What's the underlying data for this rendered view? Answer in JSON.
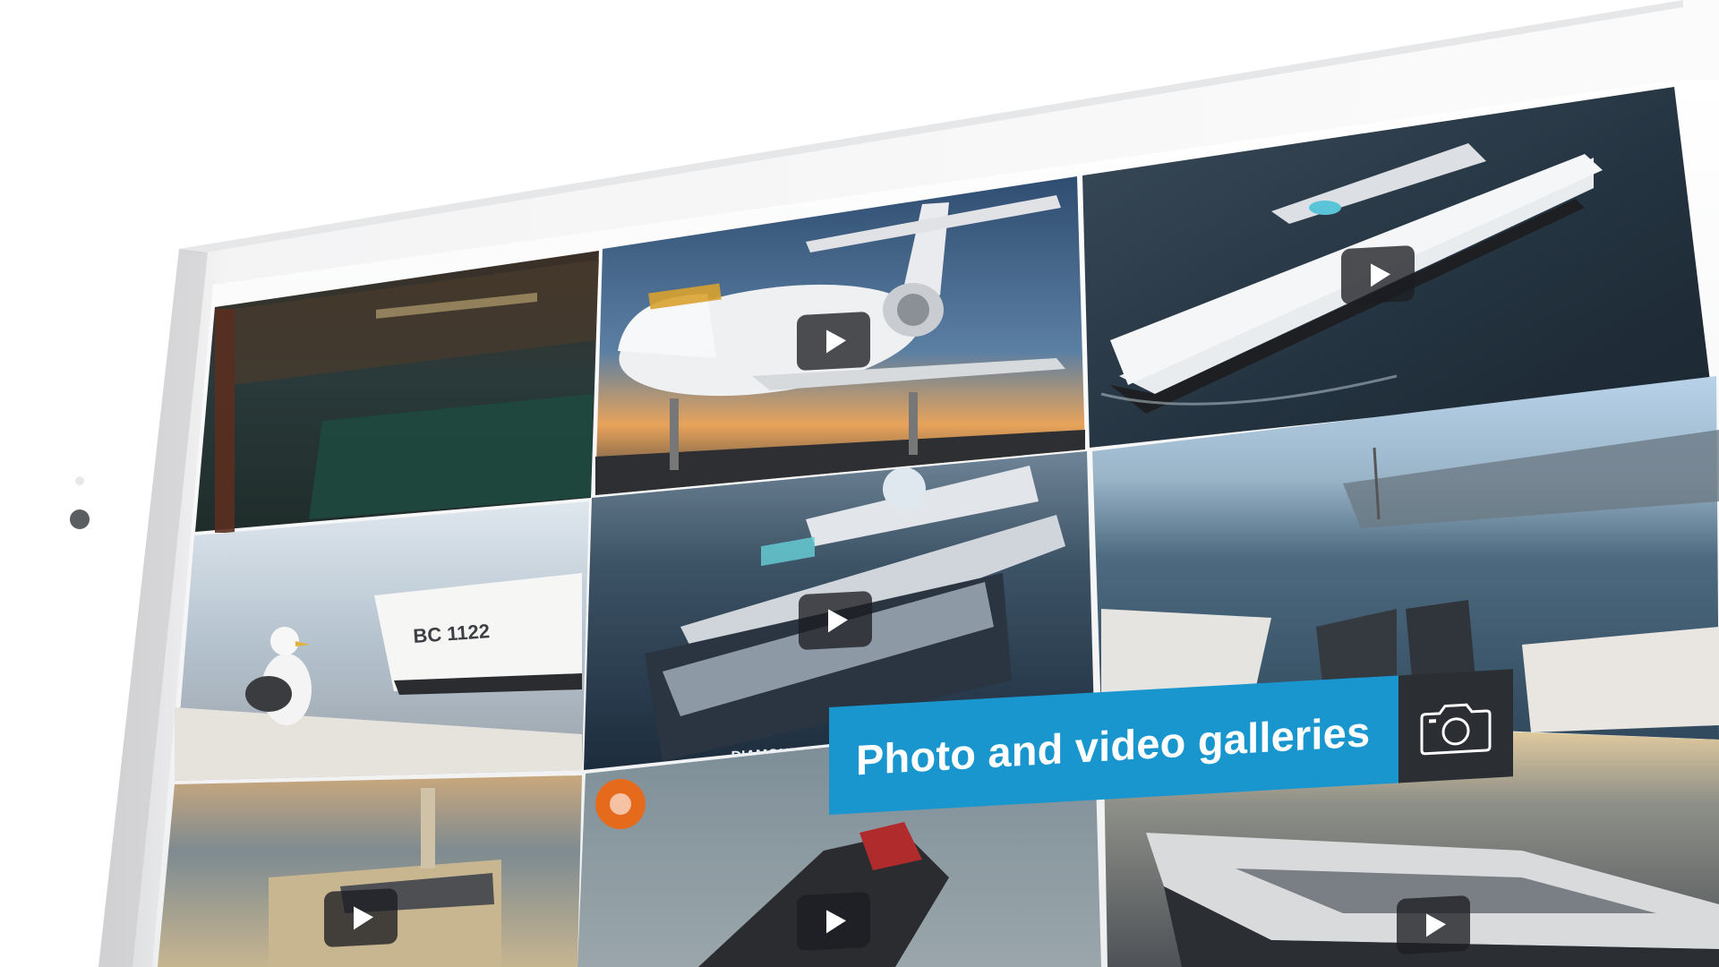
{
  "caption": {
    "label": "Photo and video galleries",
    "icon": "camera-icon",
    "accent_color": "#1a96cf",
    "icon_box_color": "#2b2e33"
  },
  "gallery": {
    "tiles": [
      {
        "name": "restaurant-bar",
        "has_play": false
      },
      {
        "name": "private-jet",
        "has_play": true
      },
      {
        "name": "superyacht-aerial",
        "has_play": true
      },
      {
        "name": "seagull-harbor",
        "has_play": false
      },
      {
        "name": "diamond-superyacht",
        "has_play": true,
        "overlay_text": "DIAMOND SU"
      },
      {
        "name": "fishing-boats-harbor",
        "has_play": false
      },
      {
        "name": "yacht-sunset",
        "has_play": true
      },
      {
        "name": "jetski-sea",
        "has_play": true
      },
      {
        "name": "sport-yacht",
        "has_play": true
      }
    ],
    "boat_registration": "BC 1122"
  }
}
